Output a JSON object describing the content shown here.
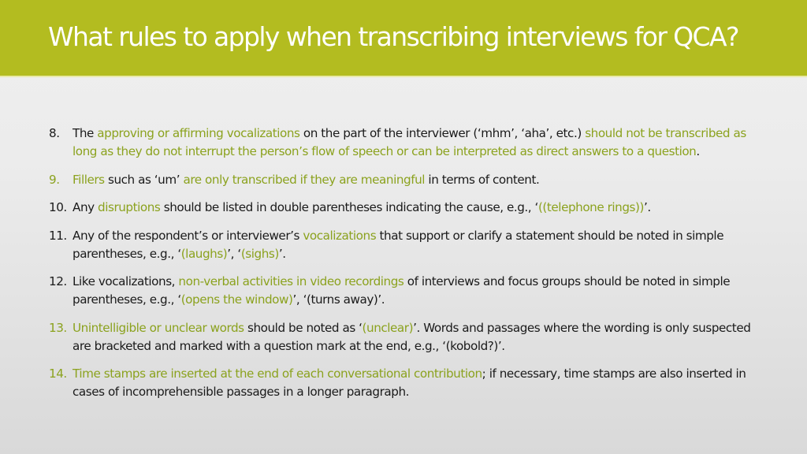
{
  "slide": {
    "title": "What rules to apply when transcribing interviews for QCA?",
    "colors": {
      "header_background": "#b3bc20",
      "title_text": "#ffffff",
      "highlight_text": "#8ba21e",
      "body_text": "#1a1a1a",
      "background_top": "#efefef",
      "background_bottom": "#d9d9d9"
    },
    "rules": [
      {
        "number": "8.",
        "number_highlighted": false,
        "segments": [
          {
            "text": "The ",
            "highlight": false
          },
          {
            "text": "approving or affirming vocalizations",
            "highlight": true
          },
          {
            "text": " on the part of the interviewer (‘mhm’, ‘aha’, etc.) ",
            "highlight": false
          },
          {
            "text": "should not be transcribed as long as they do not interrupt the person’s flow of speech or can be interpreted as direct answers to a question",
            "highlight": true
          },
          {
            "text": ".",
            "highlight": false
          }
        ]
      },
      {
        "number": "9.",
        "number_highlighted": true,
        "segments": [
          {
            "text": "Fillers",
            "highlight": true
          },
          {
            "text": " such as ‘um’ ",
            "highlight": false
          },
          {
            "text": "are only transcribed if they are meaningful",
            "highlight": true
          },
          {
            "text": " in terms of content.",
            "highlight": false
          }
        ]
      },
      {
        "number": "10.",
        "number_highlighted": false,
        "segments": [
          {
            "text": "Any ",
            "highlight": false
          },
          {
            "text": "disruptions",
            "highlight": true
          },
          {
            "text": " should be listed in double parentheses indicating the cause, e.g., ‘",
            "highlight": false
          },
          {
            "text": "((telephone rings))",
            "highlight": true
          },
          {
            "text": "’.",
            "highlight": false
          }
        ]
      },
      {
        "number": "11.",
        "number_highlighted": false,
        "segments": [
          {
            "text": "Any of the respondent’s or interviewer’s ",
            "highlight": false
          },
          {
            "text": "vocalizations",
            "highlight": true
          },
          {
            "text": " that support or clarify a statement should be noted in simple parentheses, e.g., ‘",
            "highlight": false
          },
          {
            "text": "(laughs)",
            "highlight": true
          },
          {
            "text": "’, ‘",
            "highlight": false
          },
          {
            "text": "(sighs)",
            "highlight": true
          },
          {
            "text": "’.",
            "highlight": false
          }
        ]
      },
      {
        "number": "12.",
        "number_highlighted": false,
        "segments": [
          {
            "text": "Like vocalizations, ",
            "highlight": false
          },
          {
            "text": "non-verbal activities in video recordings",
            "highlight": true
          },
          {
            "text": " of interviews and focus groups should be noted in simple parentheses, e.g., ‘",
            "highlight": false
          },
          {
            "text": "(opens the window)",
            "highlight": true
          },
          {
            "text": "’, ‘(turns away)’.",
            "highlight": false
          }
        ]
      },
      {
        "number": "13.",
        "number_highlighted": true,
        "segments": [
          {
            "text": "Unintelligible or unclear words",
            "highlight": true
          },
          {
            "text": " should be noted as ‘",
            "highlight": false
          },
          {
            "text": "(unclear)",
            "highlight": true
          },
          {
            "text": "’. Words and passages where the wording is only suspected are bracketed and marked with a question mark at the end, e.g., ‘(kobold?)’.",
            "highlight": false
          }
        ]
      },
      {
        "number": "14.",
        "number_highlighted": true,
        "segments": [
          {
            "text": "Time stamps are inserted at the end of each conversational contribution",
            "highlight": true
          },
          {
            "text": "; if necessary, time stamps are also inserted in cases of incomprehensible passages in a longer paragraph.",
            "highlight": false
          }
        ]
      }
    ]
  }
}
